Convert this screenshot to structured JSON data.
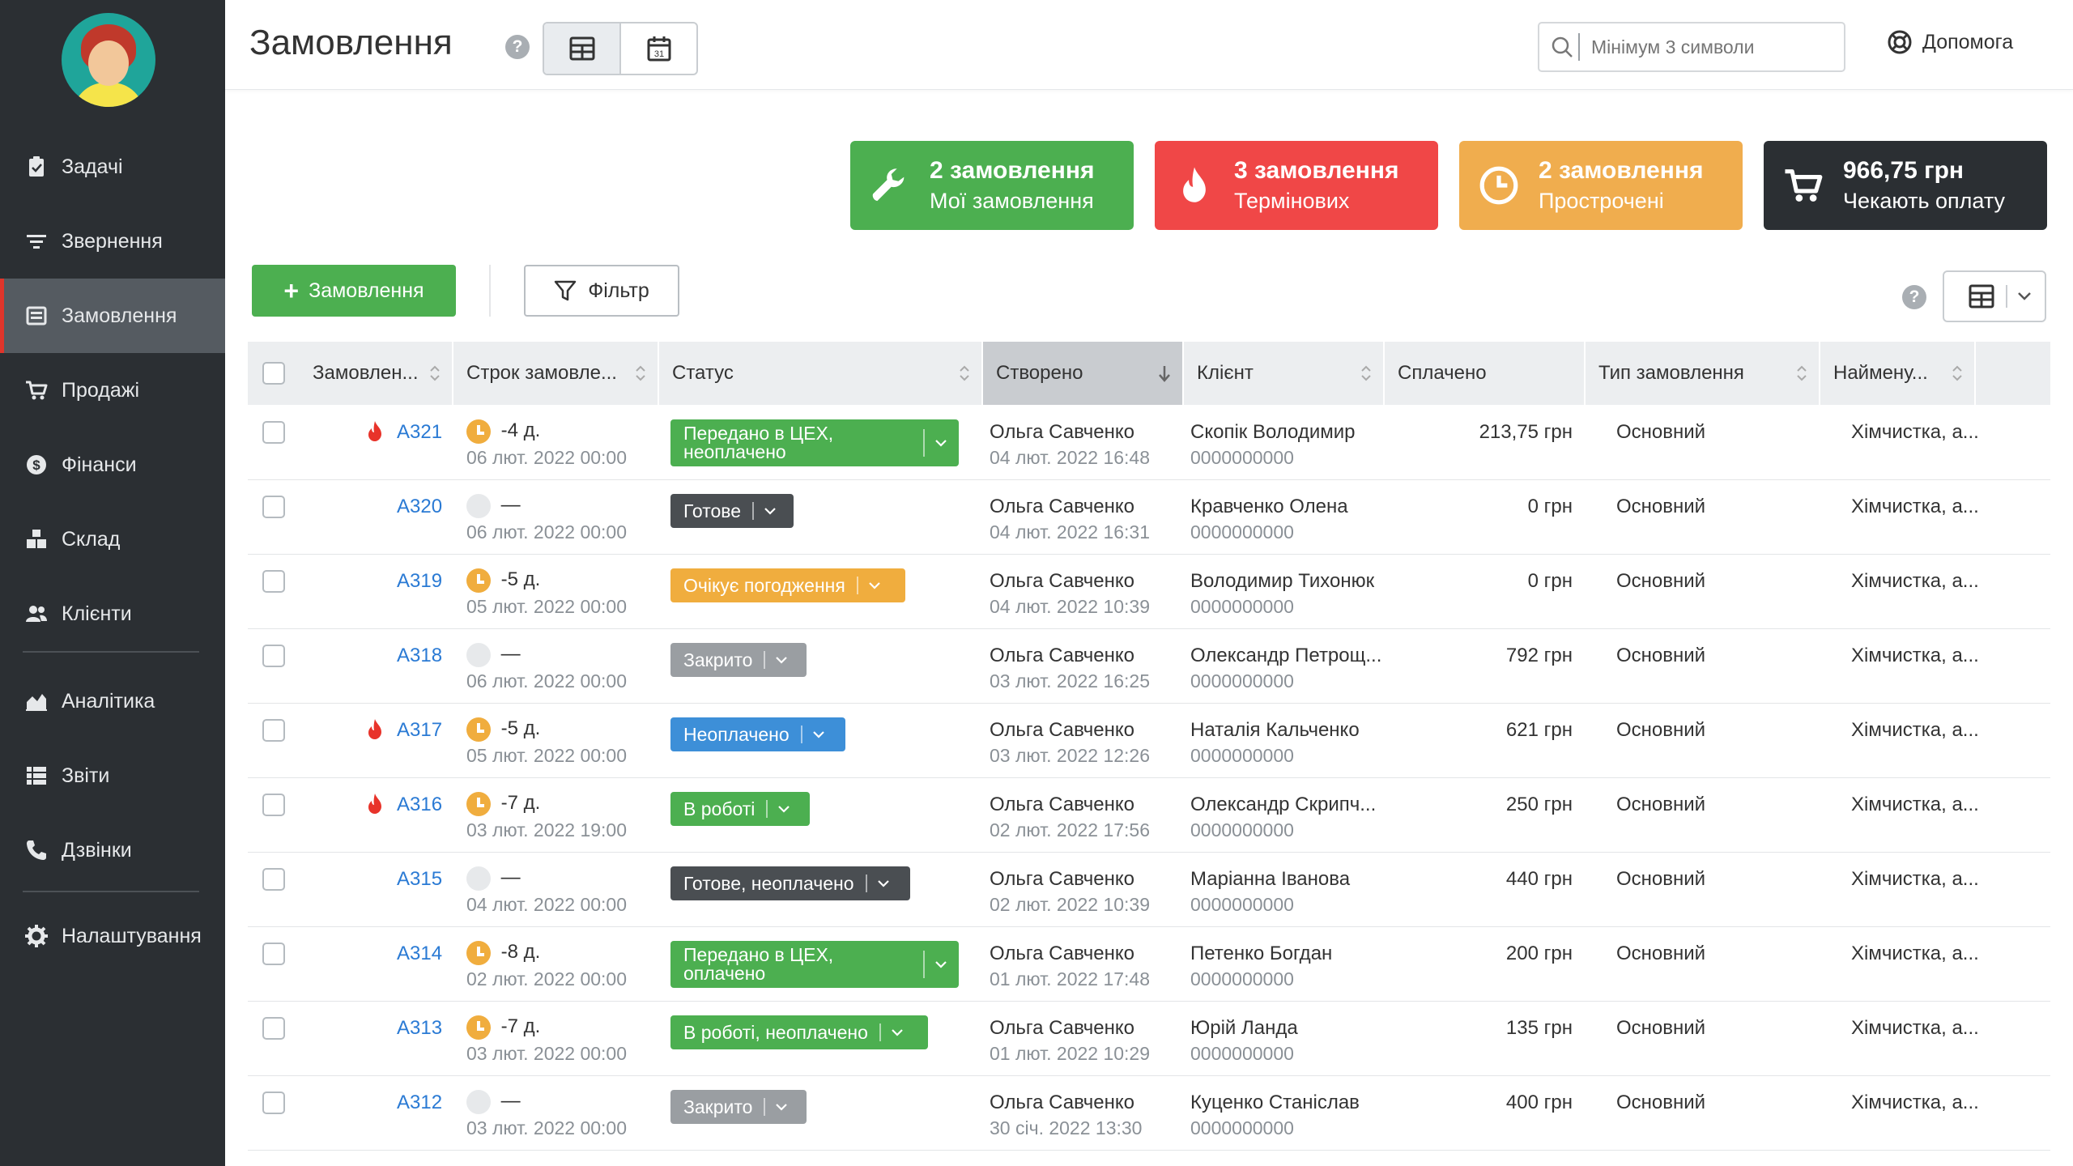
{
  "sidebar": {
    "items": [
      {
        "label": "Задачі",
        "icon": "clipboard-icon"
      },
      {
        "label": "Звернення",
        "icon": "filter-lines-icon"
      },
      {
        "label": "Замовлення",
        "icon": "order-icon"
      },
      {
        "label": "Продажі",
        "icon": "cart-icon"
      },
      {
        "label": "Фінанси",
        "icon": "dollar-icon"
      },
      {
        "label": "Склад",
        "icon": "boxes-icon"
      },
      {
        "label": "Клієнти",
        "icon": "users-icon"
      },
      {
        "label": "Аналітика",
        "icon": "area-chart-icon"
      },
      {
        "label": "Звіти",
        "icon": "list-icon"
      },
      {
        "label": "Дзвінки",
        "icon": "phone-icon"
      },
      {
        "label": "Налаштування",
        "icon": "gear-icon"
      }
    ]
  },
  "header": {
    "title": "Замовлення",
    "help": "?",
    "search_placeholder": "Мінімум 3 символи",
    "help_label": "Допомога",
    "calendar_day": "31"
  },
  "cards": [
    {
      "line1": "2 замовлення",
      "line2": "Мої замовлення",
      "color": "#4caf50",
      "icon": "wrench-icon"
    },
    {
      "line1": "3 замовлення",
      "line2": "Термінових",
      "color": "#f04747",
      "icon": "fire-icon"
    },
    {
      "line1": "2 замовлення",
      "line2": "Прострочені",
      "color": "#f0ad4e",
      "icon": "clock-icon"
    },
    {
      "line1": "966,75 грн",
      "line2": "Чекають оплату",
      "color": "#2b2f33",
      "icon": "cart-icon"
    }
  ],
  "toolbar": {
    "add_label": "Замовлення",
    "add_plus": "+",
    "filter_label": "Фільтр",
    "help": "?"
  },
  "table": {
    "columns": [
      "Замовлен...",
      "Строк замовле...",
      "Статус",
      "Створено",
      "Клієнт",
      "Сплачено",
      "Тип замовлення",
      "Наймену..."
    ],
    "rows": [
      {
        "urgent": true,
        "id": "A321",
        "term": "-4 д.",
        "term_active": true,
        "term_date": "06 лют. 2022 00:00",
        "status": "Передано в ЦЕХ, неоплачено",
        "status_lines": [
          "Передано в ЦЕХ,",
          "неоплачено"
        ],
        "status_color": "#4caf50",
        "created_by": "Ольга Савченко",
        "created_at": "04 лют. 2022 16:48",
        "client": "Скопік Володимир",
        "phone": "0000000000",
        "paid": "213,75 грн",
        "type": "Основний",
        "name": "Хімчистка, а..."
      },
      {
        "urgent": false,
        "id": "A320",
        "term": "—",
        "term_active": false,
        "term_date": "06 лют. 2022 00:00",
        "status": "Готове",
        "status_color": "#4a4e52",
        "created_by": "Ольга Савченко",
        "created_at": "04 лют. 2022 16:31",
        "client": "Кравченко Олена",
        "phone": "0000000000",
        "paid": "0 грн",
        "type": "Основний",
        "name": "Хімчистка, а..."
      },
      {
        "urgent": false,
        "id": "A319",
        "term": "-5 д.",
        "term_active": true,
        "term_date": "05 лют. 2022 00:00",
        "status": "Очікує погодження",
        "status_color": "#f0ad3e",
        "created_by": "Ольга Савченко",
        "created_at": "04 лют. 2022 10:39",
        "client": "Володимир Тихонюк",
        "phone": "0000000000",
        "paid": "0 грн",
        "type": "Основний",
        "name": "Хімчистка, а..."
      },
      {
        "urgent": false,
        "id": "A318",
        "term": "—",
        "term_active": false,
        "term_date": "06 лют. 2022 00:00",
        "status": "Закрито",
        "status_color": "#9a9ea2",
        "created_by": "Ольга Савченко",
        "created_at": "03 лют. 2022 16:25",
        "client": "Олександр Петрощ...",
        "phone": "0000000000",
        "paid": "792 грн",
        "type": "Основний",
        "name": "Хімчистка, а..."
      },
      {
        "urgent": true,
        "id": "A317",
        "term": "-5 д.",
        "term_active": true,
        "term_date": "05 лют. 2022 00:00",
        "status": "Неоплачено",
        "status_color": "#3d8fd8",
        "created_by": "Ольга Савченко",
        "created_at": "03 лют. 2022 12:26",
        "client": "Наталія Кальченко",
        "phone": "0000000000",
        "paid": "621 грн",
        "type": "Основний",
        "name": "Хімчистка, а..."
      },
      {
        "urgent": true,
        "id": "A316",
        "term": "-7 д.",
        "term_active": true,
        "term_date": "03 лют. 2022 19:00",
        "status": "В роботі",
        "status_color": "#4caf50",
        "created_by": "Ольга Савченко",
        "created_at": "02 лют. 2022 17:56",
        "client": "Олександр Скрипч...",
        "phone": "0000000000",
        "paid": "250 грн",
        "type": "Основний",
        "name": "Хімчистка, а..."
      },
      {
        "urgent": false,
        "id": "A315",
        "term": "—",
        "term_active": false,
        "term_date": "04 лют. 2022 00:00",
        "status": "Готове, неоплачено",
        "status_color": "#4a4e52",
        "created_by": "Ольга Савченко",
        "created_at": "02 лют. 2022 10:39",
        "client": "Маріанна Іванова",
        "phone": "0000000000",
        "paid": "440 грн",
        "type": "Основний",
        "name": "Хімчистка, а..."
      },
      {
        "urgent": false,
        "id": "A314",
        "term": "-8 д.",
        "term_active": true,
        "term_date": "02 лют. 2022 00:00",
        "status": "Передано в ЦЕХ, оплачено",
        "status_lines": [
          "Передано в ЦЕХ,",
          "оплачено"
        ],
        "status_color": "#4caf50",
        "created_by": "Ольга Савченко",
        "created_at": "01 лют. 2022 17:48",
        "client": "Петенко Богдан",
        "phone": "0000000000",
        "paid": "200 грн",
        "type": "Основний",
        "name": "Хімчистка, а..."
      },
      {
        "urgent": false,
        "id": "A313",
        "term": "-7 д.",
        "term_active": true,
        "term_date": "03 лют. 2022 00:00",
        "status": "В роботі, неоплачено",
        "status_color": "#4caf50",
        "created_by": "Ольга Савченко",
        "created_at": "01 лют. 2022 10:29",
        "client": "Юрій Ланда",
        "phone": "0000000000",
        "paid": "135 грн",
        "type": "Основний",
        "name": "Хімчистка, а..."
      },
      {
        "urgent": false,
        "id": "A312",
        "term": "—",
        "term_active": false,
        "term_date": "03 лют. 2022 00:00",
        "status": "Закрито",
        "status_color": "#9a9ea2",
        "created_by": "Ольга Савченко",
        "created_at": "30 січ. 2022 13:30",
        "client": "Куценко Станіслав",
        "phone": "0000000000",
        "paid": "400 грн",
        "type": "Основний",
        "name": "Хімчистка, а..."
      }
    ]
  }
}
